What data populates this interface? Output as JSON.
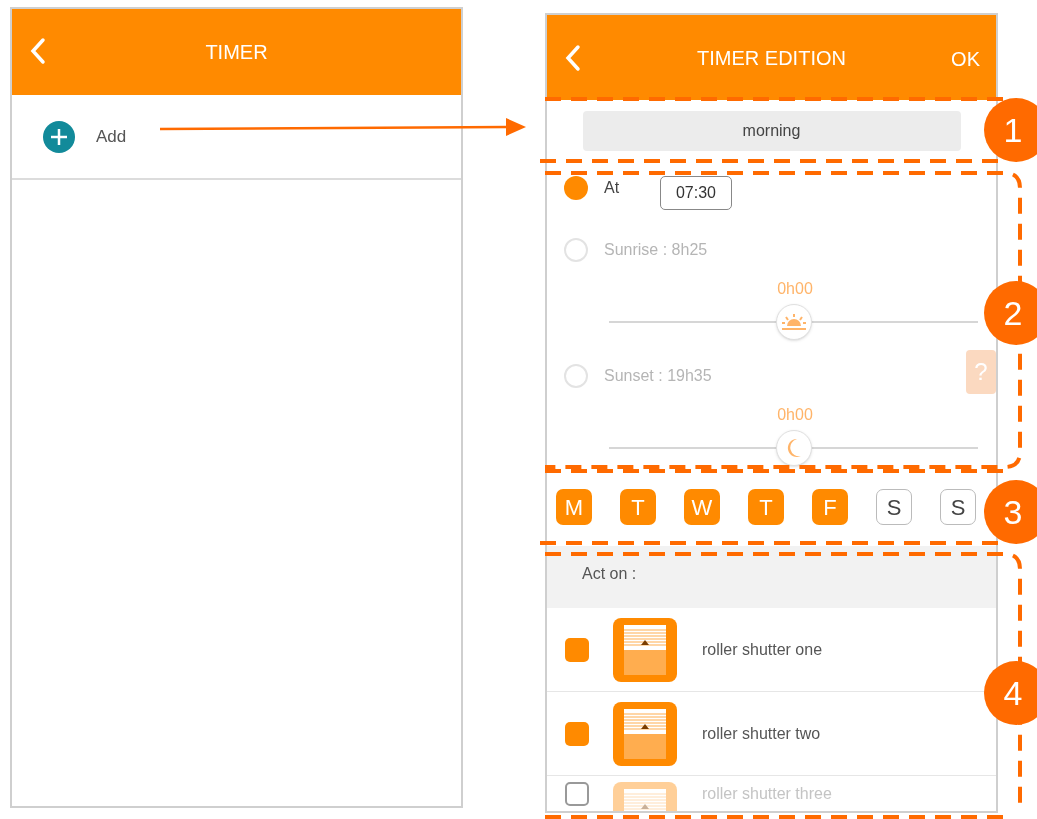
{
  "timer_screen": {
    "title": "TIMER",
    "add_label": "Add"
  },
  "edition_screen": {
    "title": "TIMER EDITION",
    "ok_label": "OK",
    "name_value": "morning",
    "modes": [
      {
        "kind": "time",
        "label": "At",
        "value": "07:30",
        "selected": true
      },
      {
        "kind": "sunrise",
        "label": "Sunrise : 8h25",
        "offset": "0h00",
        "level": 0.5,
        "selected": false
      },
      {
        "kind": "sunset",
        "label": "Sunset : 19h35",
        "offset": "0h00",
        "level": 0.5,
        "selected": false
      }
    ],
    "help_label": "?",
    "days": [
      {
        "label": "M",
        "selected": true
      },
      {
        "label": "T",
        "selected": true
      },
      {
        "label": "W",
        "selected": true
      },
      {
        "label": "T",
        "selected": true
      },
      {
        "label": "F",
        "selected": true
      },
      {
        "label": "S",
        "selected": false
      },
      {
        "label": "S",
        "selected": false
      }
    ],
    "act_on_label": "Act on :",
    "devices": [
      {
        "name": "roller shutter one",
        "checked": true,
        "disabled": false
      },
      {
        "name": "roller shutter two",
        "checked": true,
        "disabled": false
      },
      {
        "name": "roller shutter three",
        "checked": false,
        "disabled": true
      }
    ]
  },
  "callouts": [
    "1",
    "2",
    "3",
    "4"
  ]
}
